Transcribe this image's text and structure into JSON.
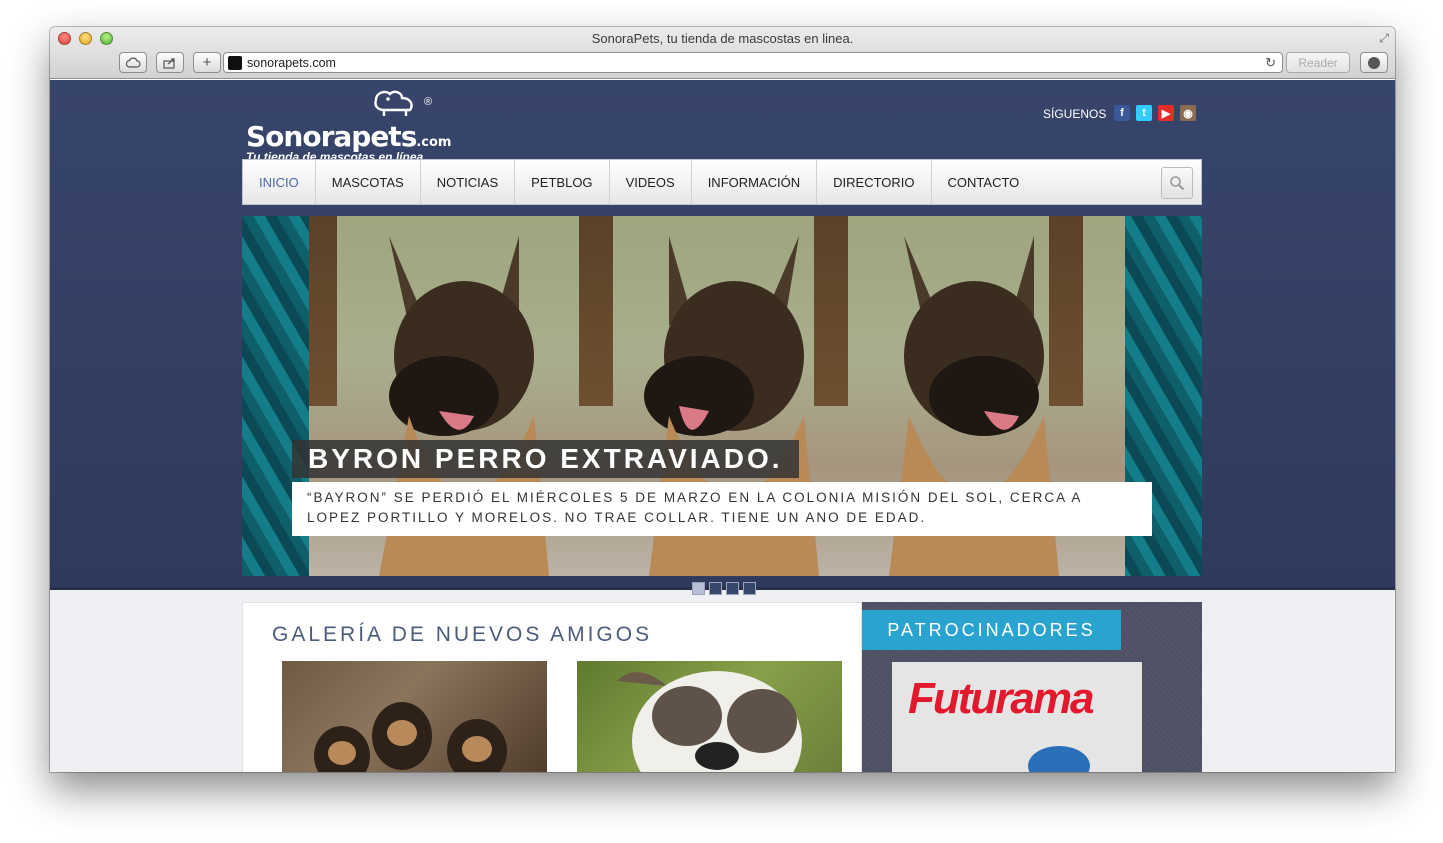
{
  "browser": {
    "title": "SonoraPets, tu tienda de mascostas en linea.",
    "url": "sonorapets.com",
    "reader_label": "Reader"
  },
  "header": {
    "logo_name": "Sonorapets",
    "logo_suffix": ".com",
    "logo_tagline": "Tu tienda de mascotas en línea",
    "logo_reg": "®",
    "follow_label": "SÍGUENOS",
    "social": [
      "facebook-icon",
      "twitter-icon",
      "youtube-icon",
      "instagram-icon"
    ]
  },
  "nav": {
    "items": [
      {
        "label": "INICIO"
      },
      {
        "label": "MASCOTAS"
      },
      {
        "label": "NOTICIAS"
      },
      {
        "label": "PETBLOG"
      },
      {
        "label": "VIDEOS"
      },
      {
        "label": "INFORMACIÓN"
      },
      {
        "label": "DIRECTORIO"
      },
      {
        "label": "CONTACTO"
      }
    ],
    "active": "INICIO"
  },
  "slider": {
    "title": "BYRON PERRO EXTRAVIADO.",
    "text": "“BAYRON” SE PERDIÓ EL MIÉRCOLES 5 DE MARZO EN LA COLONIA MISIÓN DEL SOL, CERCA A LOPEZ PORTILLO Y MORELOS. NO TRAE COLLAR. TIENE UN ANO DE EDAD.",
    "slide_count": 4,
    "current_slide": 1
  },
  "gallery": {
    "title": "GALERÍA DE NUEVOS AMIGOS"
  },
  "sponsors": {
    "label": "PATROCINADORES",
    "sponsor_name": "Futurama"
  },
  "colors": {
    "header_bg": "#34416a",
    "accent": "#2aa3cf",
    "nav_active": "#4e6aa8",
    "sponsor_red": "#e3182d"
  }
}
